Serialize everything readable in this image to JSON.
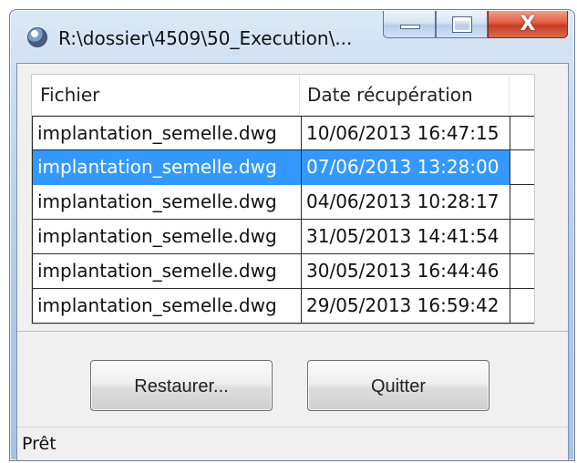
{
  "window": {
    "title": "R:\\dossier\\4509\\50_Execution\\...",
    "close_glyph": "X"
  },
  "grid": {
    "columns": [
      "Fichier",
      "Date récupération"
    ],
    "rows": [
      {
        "file": "implantation_semelle.dwg",
        "date": "10/06/2013 16:47:15",
        "selected": false
      },
      {
        "file": "implantation_semelle.dwg",
        "date": "07/06/2013 13:28:00",
        "selected": true
      },
      {
        "file": "implantation_semelle.dwg",
        "date": "04/06/2013 10:28:17",
        "selected": false
      },
      {
        "file": "implantation_semelle.dwg",
        "date": "31/05/2013 14:41:54",
        "selected": false
      },
      {
        "file": "implantation_semelle.dwg",
        "date": "30/05/2013 16:44:46",
        "selected": false
      },
      {
        "file": "implantation_semelle.dwg",
        "date": "29/05/2013 16:59:42",
        "selected": false
      }
    ]
  },
  "buttons": {
    "restore_label": "Restaurer...",
    "quit_label": "Quitter"
  },
  "status": {
    "text": "Prêt"
  },
  "colors": {
    "selection": "#3399ff",
    "close_button": "#c33d24"
  },
  "icons": {
    "app": "app-icon",
    "minimize": "minimize-icon",
    "maximize": "maximize-icon",
    "close": "close-icon"
  }
}
